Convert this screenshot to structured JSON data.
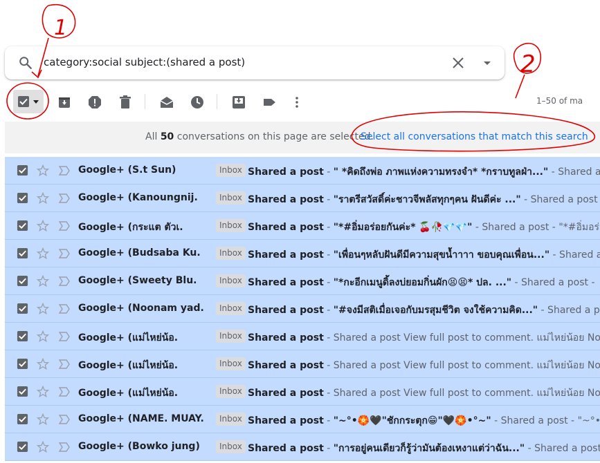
{
  "search": {
    "query": "category:social subject:(shared a post)",
    "search_icon": "search-icon",
    "clear_icon": "close-icon",
    "options_icon": "caret-down-icon"
  },
  "toolbar": {
    "select_all_icon": "checkbox-checked-icon",
    "archive_icon": "archive-icon",
    "spam_icon": "report-spam-icon",
    "delete_icon": "trash-icon",
    "mark_read_icon": "mark-as-read-icon",
    "snooze_icon": "clock-icon",
    "move_icon": "move-to-inbox-icon",
    "label_icon": "label-icon",
    "more_icon": "more-vert-icon",
    "pager": "1–50 of ma"
  },
  "banner": {
    "prefix": "All",
    "count": "50",
    "suffix": "conversations on this page are selected.",
    "link": "Select all conversations that match this search"
  },
  "annotations": {
    "mark1": "1",
    "mark2": "2",
    "color": "#e00000"
  },
  "colors": {
    "selected_row": "#c2dbff",
    "link": "#1a73e8",
    "checkbox": "#5f6368"
  },
  "rows": [
    {
      "sender": "Google+ (S.t Sun)",
      "badge": "Inbox",
      "subject": "Shared a post",
      "dash": " - ",
      "snippet_main": "\" *คิดถึงพ่อ ภาพแห่งความทรงจำ* *กราบทูลฝ่า...\"",
      "snippet_rest": " - Shared a"
    },
    {
      "sender": "Google+ (Kanoungnij.",
      "badge": "Inbox",
      "subject": "Shared a post",
      "dash": " - ",
      "snippet_main": "\"ราตรีสวัสดิ์ค่ะชาวจีพลัสทุกๆคน ฝันดีค่ะ ...\"",
      "snippet_rest": " - Shared a post -"
    },
    {
      "sender": "Google+ (กระแต ตัวเ.",
      "badge": "Inbox",
      "subject": "Shared a post",
      "dash": " - ",
      "snippet_main": "\"*#อิ่มอร่อยกันค่ะ* 🍒🥀💎💎\"",
      "snippet_rest": " - Shared a post - \"*#อิ่มอร่อย"
    },
    {
      "sender": "Google+ (Budsaba Ku.",
      "badge": "Inbox",
      "subject": "Shared a post",
      "dash": " - ",
      "snippet_main": "\"เพื่อนๆหลับฝันดีมีความสุขนํ้าาาา ขอบคุณเพื่อน...\"",
      "snippet_rest": " - Shared a"
    },
    {
      "sender": "Google+ (Sweety Blu.",
      "badge": "Inbox",
      "subject": "Shared a post",
      "dash": " - ",
      "snippet_main": "\"*กะอีกเมนูดิ้ลงบ่ยอมกิ่นผัก😫😫* ปล. ...\"",
      "snippet_rest": " - Shared a post -"
    },
    {
      "sender": "Google+ (Noonam yad.",
      "badge": "Inbox",
      "subject": "Shared a post",
      "dash": " - ",
      "snippet_main": "\"#จงมีสติเมื่อเจอกับมรสุมชีวิต จงใช้ความคิด...\"",
      "snippet_rest": " - Shared a p"
    },
    {
      "sender": "Google+ (แม่ไหย่น้อ.",
      "badge": "Inbox",
      "subject": "Shared a post",
      "dash": " - ",
      "snippet_main": "",
      "snippet_rest": "Shared a post View full post to comment. แม่ไหย่น้อย Noi fre"
    },
    {
      "sender": "Google+ (แม่ไหย่น้อ.",
      "badge": "Inbox",
      "subject": "Shared a post",
      "dash": " - ",
      "snippet_main": "",
      "snippet_rest": "Shared a post View full post to comment. แม่ไหย่น้อย Noi fre"
    },
    {
      "sender": "Google+ (แม่ไหย่น้อ.",
      "badge": "Inbox",
      "subject": "Shared a post",
      "dash": " - ",
      "snippet_main": "",
      "snippet_rest": "Shared a post View full post to comment. แม่ไหย่น้อย Noi fre"
    },
    {
      "sender": "Google+ (NAME. MUAY.",
      "badge": "Inbox",
      "subject": "Shared a post",
      "dash": " - ",
      "snippet_main": "\"~°•🏵️🖤\"ชักกระตุก😁\"🖤🏵️•°~\"",
      "snippet_rest": " - Shared a post - \"~°•🏵️"
    },
    {
      "sender": "Google+ (Bowko jung)",
      "badge": "Inbox",
      "subject": "Shared a post",
      "dash": " - ",
      "snippet_main": "\"การอยู่คนเดียวก็รู้ว่ามันต้องเหงาแต่ว่าฉัน...\"",
      "snippet_rest": " - Shared a post"
    }
  ]
}
